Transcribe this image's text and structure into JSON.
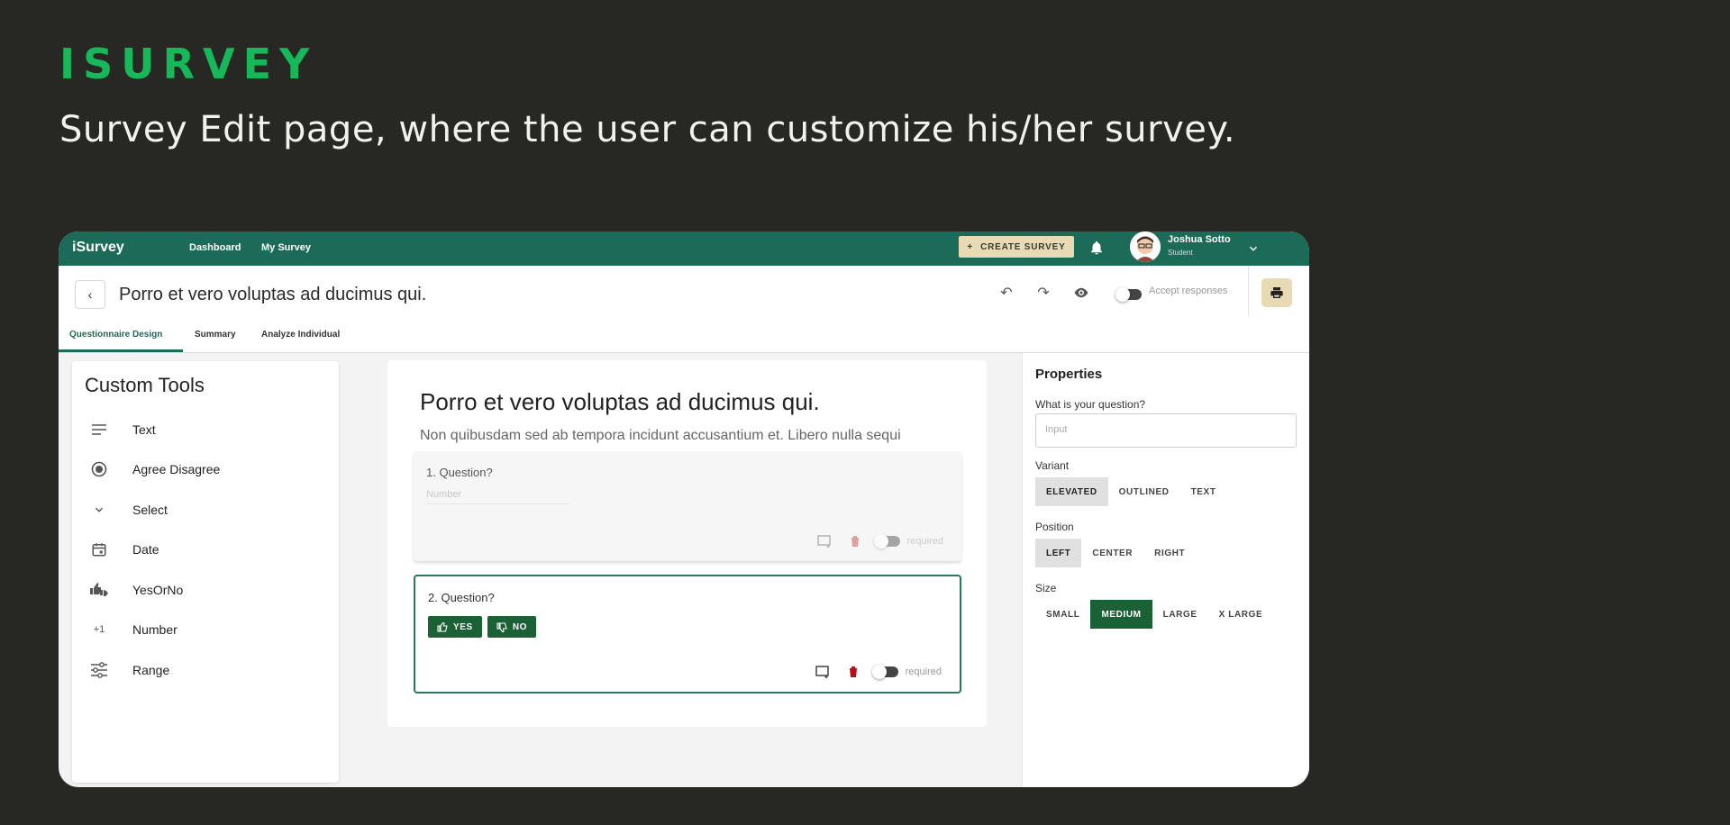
{
  "brand": {
    "title": "ISURVEY",
    "subtitle": "Survey Edit page, where the user can customize his/her survey."
  },
  "nav": {
    "logo": "iSurvey",
    "links": [
      "Dashboard",
      "My Survey"
    ],
    "create_label": "CREATE SURVEY",
    "user": {
      "name": "Joshua Sotto",
      "role": "Student"
    }
  },
  "header": {
    "title": "Porro et vero voluptas ad ducimus qui.",
    "accept_label": "Accept responses",
    "tabs": [
      "Questionnaire Design",
      "Summary",
      "Analyze Individual"
    ]
  },
  "tools": {
    "title": "Custom Tools",
    "items": [
      {
        "label": "Text",
        "icon": "text-lines-icon"
      },
      {
        "label": "Agree Disagree",
        "icon": "radio-icon"
      },
      {
        "label": "Select",
        "icon": "chevron-down-icon"
      },
      {
        "label": "Date",
        "icon": "calendar-icon"
      },
      {
        "label": "YesOrNo",
        "icon": "thumbs-icon"
      },
      {
        "label": "Number",
        "icon": "plus-one-icon"
      },
      {
        "label": "Range",
        "icon": "sliders-icon"
      }
    ]
  },
  "survey": {
    "title": "Porro et vero voluptas ad ducimus qui.",
    "description": "Non quibusdam sed ab tempora incidunt accusantium et. Libero nulla sequi",
    "questions": [
      {
        "label": "1. Question?",
        "placeholder": "Number",
        "required_label": "required"
      },
      {
        "label": "2. Question?",
        "yes_label": "YES",
        "no_label": "NO",
        "required_label": "required"
      }
    ]
  },
  "properties": {
    "title": "Properties",
    "question_label": "What is your question?",
    "input_placeholder": "Input",
    "variant_label": "Variant",
    "variant_options": [
      "ELEVATED",
      "OUTLINED",
      "TEXT"
    ],
    "variant_selected": "ELEVATED",
    "position_label": "Position",
    "position_options": [
      "LEFT",
      "CENTER",
      "RIGHT"
    ],
    "position_selected": "LEFT",
    "size_label": "Size",
    "size_options": [
      "SMALL",
      "MEDIUM",
      "LARGE",
      "X LARGE"
    ],
    "size_selected": "MEDIUM"
  },
  "colors": {
    "brand_green": "#16b85a",
    "nav_teal": "#1c6b58",
    "accent_sand": "#e7dab4",
    "button_green": "#1b6136",
    "background": "#272723"
  }
}
